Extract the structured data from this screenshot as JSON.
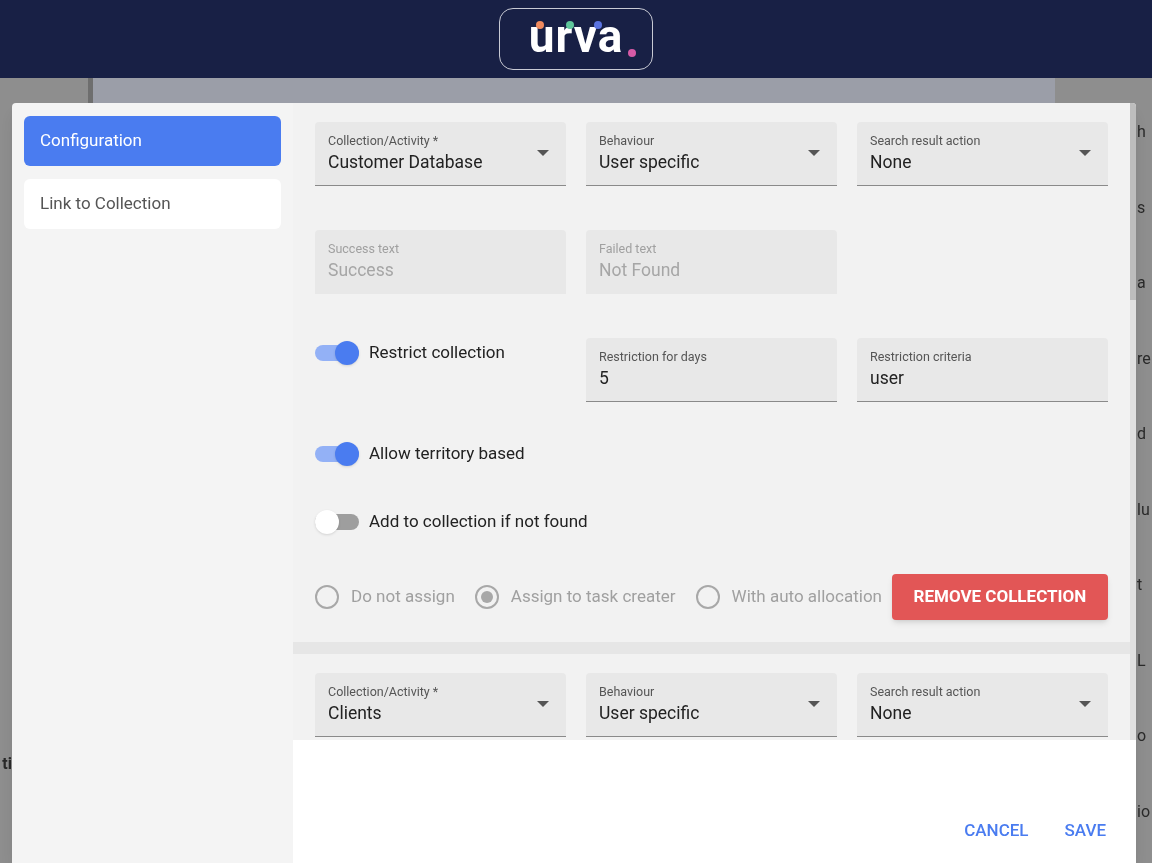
{
  "header": {
    "logo": "urva"
  },
  "background": {
    "right_fragments": [
      "h",
      "s",
      "a",
      "re",
      "d",
      "lu",
      "t",
      "L",
      "o",
      "io"
    ],
    "left_fragments": [
      "ti"
    ]
  },
  "sidebar": {
    "items": [
      {
        "label": "Configuration",
        "selected": true
      },
      {
        "label": "Link to Collection",
        "selected": false
      }
    ]
  },
  "collections": [
    {
      "selects": [
        {
          "label": "Collection/Activity *",
          "value": "Customer Database"
        },
        {
          "label": "Behaviour",
          "value": "User specific"
        },
        {
          "label": "Search result action",
          "value": "None"
        }
      ],
      "messages": [
        {
          "label": "Success text",
          "value": "Success",
          "disabled": true
        },
        {
          "label": "Failed text",
          "value": "Not Found",
          "disabled": true
        }
      ],
      "toggles": [
        {
          "label": "Restrict collection",
          "on": true,
          "fields": [
            {
              "label": "Restriction for days",
              "value": "5"
            },
            {
              "label": "Restriction criteria",
              "value": "user"
            }
          ]
        },
        {
          "label": "Allow territory based",
          "on": true
        },
        {
          "label": "Add to collection if not found",
          "on": false
        }
      ],
      "assignment": {
        "disabled": true,
        "options": [
          {
            "label": "Do not assign",
            "selected": false
          },
          {
            "label": "Assign to task creater",
            "selected": true
          },
          {
            "label": "With auto allocation",
            "selected": false
          }
        ]
      },
      "remove_button": "REMOVE COLLECTION"
    },
    {
      "selects": [
        {
          "label": "Collection/Activity *",
          "value": "Clients"
        },
        {
          "label": "Behaviour",
          "value": "User specific"
        },
        {
          "label": "Search result action",
          "value": "None"
        }
      ]
    }
  ],
  "footer": {
    "buttons": [
      {
        "label": "CANCEL"
      },
      {
        "label": "SAVE"
      }
    ]
  }
}
